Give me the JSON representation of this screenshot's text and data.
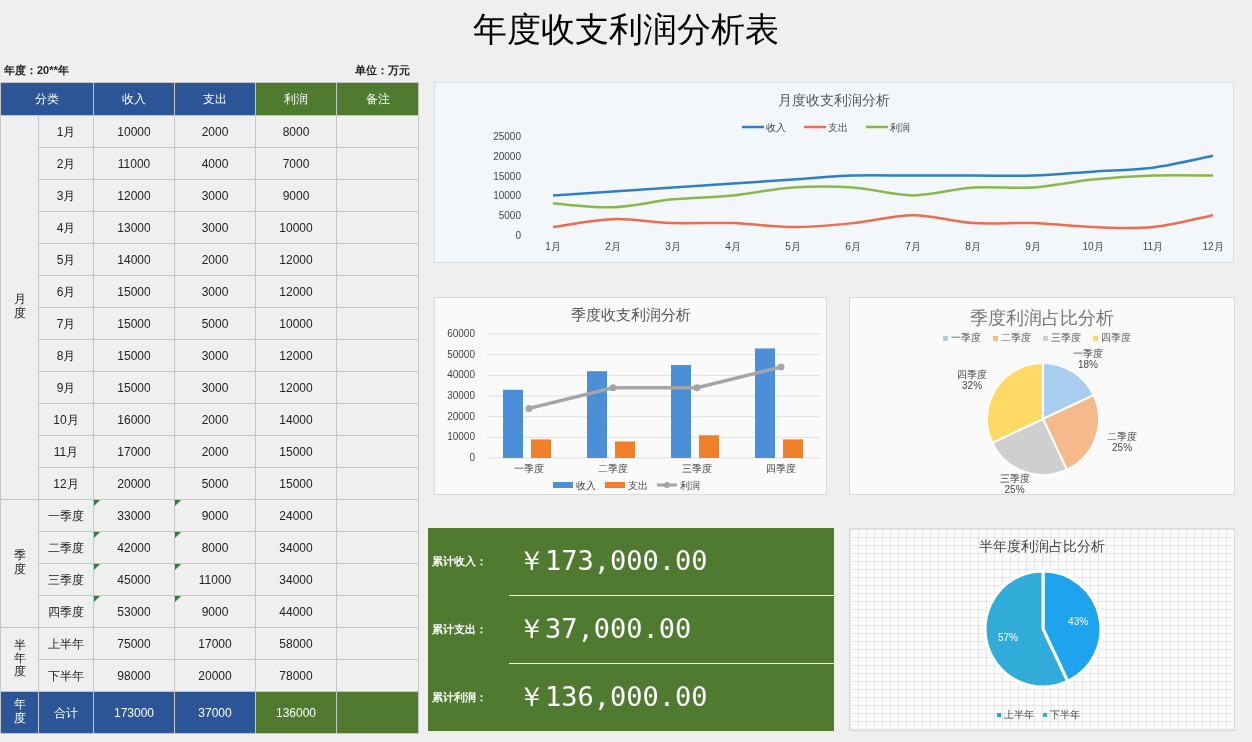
{
  "title": "年度收支利润分析表",
  "year_label": "年度：20**年",
  "unit_label": "单位：万元",
  "table": {
    "columns": [
      {
        "label": "分类",
        "color": "#2b5597"
      },
      {
        "label": "收入",
        "color": "#2b5597"
      },
      {
        "label": "支出",
        "color": "#2b5597"
      },
      {
        "label": "利润",
        "color": "#4f7a2f"
      },
      {
        "label": "备注",
        "color": "#4f7a2f"
      }
    ],
    "groups": [
      {
        "label": "月度",
        "kind": "data",
        "rows": [
          {
            "name": "1月",
            "values": [
              "10000",
              "2000",
              "8000"
            ],
            "flagged": false
          },
          {
            "name": "2月",
            "values": [
              "11000",
              "4000",
              "7000"
            ],
            "flagged": false
          },
          {
            "name": "3月",
            "values": [
              "12000",
              "3000",
              "9000"
            ],
            "flagged": false
          },
          {
            "name": "4月",
            "values": [
              "13000",
              "3000",
              "10000"
            ],
            "flagged": false
          },
          {
            "name": "5月",
            "values": [
              "14000",
              "2000",
              "12000"
            ],
            "flagged": false
          },
          {
            "name": "6月",
            "values": [
              "15000",
              "3000",
              "12000"
            ],
            "flagged": false
          },
          {
            "name": "7月",
            "values": [
              "15000",
              "5000",
              "10000"
            ],
            "flagged": false
          },
          {
            "name": "8月",
            "values": [
              "15000",
              "3000",
              "12000"
            ],
            "flagged": false
          },
          {
            "name": "9月",
            "values": [
              "15000",
              "3000",
              "12000"
            ],
            "flagged": false
          },
          {
            "name": "10月",
            "values": [
              "16000",
              "2000",
              "14000"
            ],
            "flagged": false
          },
          {
            "name": "11月",
            "values": [
              "17000",
              "2000",
              "15000"
            ],
            "flagged": false
          },
          {
            "name": "12月",
            "values": [
              "20000",
              "5000",
              "15000"
            ],
            "flagged": false
          }
        ]
      },
      {
        "label": "季度",
        "kind": "data",
        "rows": [
          {
            "name": "一季度",
            "values": [
              "33000",
              "9000",
              "24000"
            ],
            "flagged": true
          },
          {
            "name": "二季度",
            "values": [
              "42000",
              "8000",
              "34000"
            ],
            "flagged": true
          },
          {
            "name": "三季度",
            "values": [
              "45000",
              "11000",
              "34000"
            ],
            "flagged": true
          },
          {
            "name": "四季度",
            "values": [
              "53000",
              "9000",
              "44000"
            ],
            "flagged": true
          }
        ]
      },
      {
        "label": "半年度",
        "kind": "data",
        "rows": [
          {
            "name": "上半年",
            "values": [
              "75000",
              "17000",
              "58000"
            ],
            "flagged": false
          },
          {
            "name": "下半年",
            "values": [
              "98000",
              "20000",
              "78000"
            ],
            "flagged": false
          }
        ]
      },
      {
        "label": "年度",
        "kind": "total",
        "rows": [
          {
            "name": "合计",
            "values": [
              "173000",
              "37000",
              "136000"
            ],
            "flagged": false
          }
        ]
      }
    ]
  },
  "monthly_chart": {
    "chart_data": {
      "type": "line",
      "title": "月度收支利润分析",
      "legend": true,
      "categories": [
        "1月",
        "2月",
        "3月",
        "4月",
        "5月",
        "6月",
        "7月",
        "8月",
        "9月",
        "10月",
        "11月",
        "12月"
      ],
      "ylim": [
        0,
        25000
      ],
      "yticks": [
        0,
        5000,
        10000,
        15000,
        20000,
        25000
      ],
      "series": [
        {
          "name": "收入",
          "color": "#2f7fc8",
          "values": [
            10000,
            11000,
            12000,
            13000,
            14000,
            15000,
            15000,
            15000,
            15000,
            16000,
            17000,
            20000
          ]
        },
        {
          "name": "支出",
          "color": "#ee6a50",
          "values": [
            2000,
            4000,
            3000,
            3000,
            2000,
            3000,
            5000,
            3000,
            3000,
            2000,
            2000,
            5000
          ]
        },
        {
          "name": "利润",
          "color": "#86b84a",
          "values": [
            8000,
            7000,
            9000,
            10000,
            12000,
            12000,
            10000,
            12000,
            12000,
            14000,
            15000,
            15000
          ]
        }
      ]
    }
  },
  "quarter_chart": {
    "chart_data": {
      "type": "bar",
      "title": "季度收支利润分析",
      "legend": true,
      "grid": true,
      "stacked": false,
      "categories": [
        "一季度",
        "二季度",
        "三季度",
        "四季度"
      ],
      "ylim": [
        0,
        60000
      ],
      "yticks": [
        0,
        10000,
        20000,
        30000,
        40000,
        50000,
        60000
      ],
      "series": [
        {
          "name": "收入",
          "color": "#4a8fd8",
          "type": "bar",
          "values": [
            33000,
            42000,
            45000,
            53000
          ]
        },
        {
          "name": "支出",
          "color": "#f07f2a",
          "type": "bar",
          "values": [
            9000,
            8000,
            11000,
            9000
          ]
        },
        {
          "name": "利润",
          "color": "#a5a5a5",
          "type": "line",
          "marker": true,
          "values": [
            24000,
            34000,
            34000,
            44000
          ]
        }
      ]
    }
  },
  "quarter_pie": {
    "chart_data": {
      "type": "pie",
      "title": "季度利润占比分析",
      "legend": true,
      "categories": [
        "一季度",
        "二季度",
        "三季度",
        "四季度"
      ],
      "values": [
        18,
        25,
        25,
        32
      ],
      "value_labels": [
        "18%",
        "25%",
        "25%",
        "32%"
      ],
      "colors": [
        "#a9cdee",
        "#f5b98c",
        "#cfcfcf",
        "#ffd966"
      ]
    }
  },
  "summary": [
    {
      "label": "累计收入：",
      "value": "￥173,000.00"
    },
    {
      "label": "累计支出：",
      "value": "￥37,000.00"
    },
    {
      "label": "累计利润：",
      "value": "￥136,000.00"
    }
  ],
  "half_pie": {
    "chart_data": {
      "type": "pie",
      "title": "半年度利润占比分析",
      "legend": true,
      "categories": [
        "上半年",
        "下半年"
      ],
      "values": [
        43,
        57
      ],
      "value_labels": [
        "43%",
        "57%"
      ],
      "colors": [
        "#1ea4ee",
        "#31acd8"
      ]
    }
  }
}
